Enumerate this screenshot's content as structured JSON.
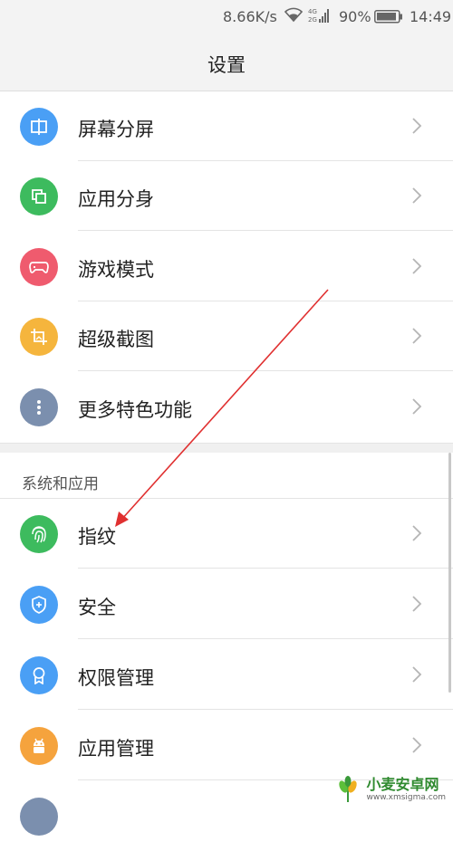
{
  "status_bar": {
    "speed": "8.66K/s",
    "battery_percent": "90%",
    "time": "14:49",
    "network_labels": [
      "4G",
      "2G"
    ]
  },
  "header": {
    "title": "设置"
  },
  "group_one": [
    {
      "label": "屏幕分屏",
      "icon": "split-screen-icon",
      "color": "#4a9ff5"
    },
    {
      "label": "应用分身",
      "icon": "app-clone-icon",
      "color": "#3dbb5e"
    },
    {
      "label": "游戏模式",
      "icon": "gamepad-icon",
      "color": "#ef5b6e"
    },
    {
      "label": "超级截图",
      "icon": "screenshot-crop-icon",
      "color": "#f5b53d"
    },
    {
      "label": "更多特色功能",
      "icon": "more-dots-icon",
      "color": "#7b8fae"
    }
  ],
  "section": {
    "title": "系统和应用"
  },
  "group_two": [
    {
      "label": "指纹",
      "icon": "fingerprint-icon",
      "color": "#3dbb5e"
    },
    {
      "label": "安全",
      "icon": "shield-icon",
      "color": "#4a9ff5"
    },
    {
      "label": "权限管理",
      "icon": "permission-badge-icon",
      "color": "#4a9ff5"
    },
    {
      "label": "应用管理",
      "icon": "android-robot-icon",
      "color": "#f5a33d"
    }
  ],
  "watermark": {
    "name": "小麦安卓网",
    "url": "www.xmsigma.com"
  }
}
